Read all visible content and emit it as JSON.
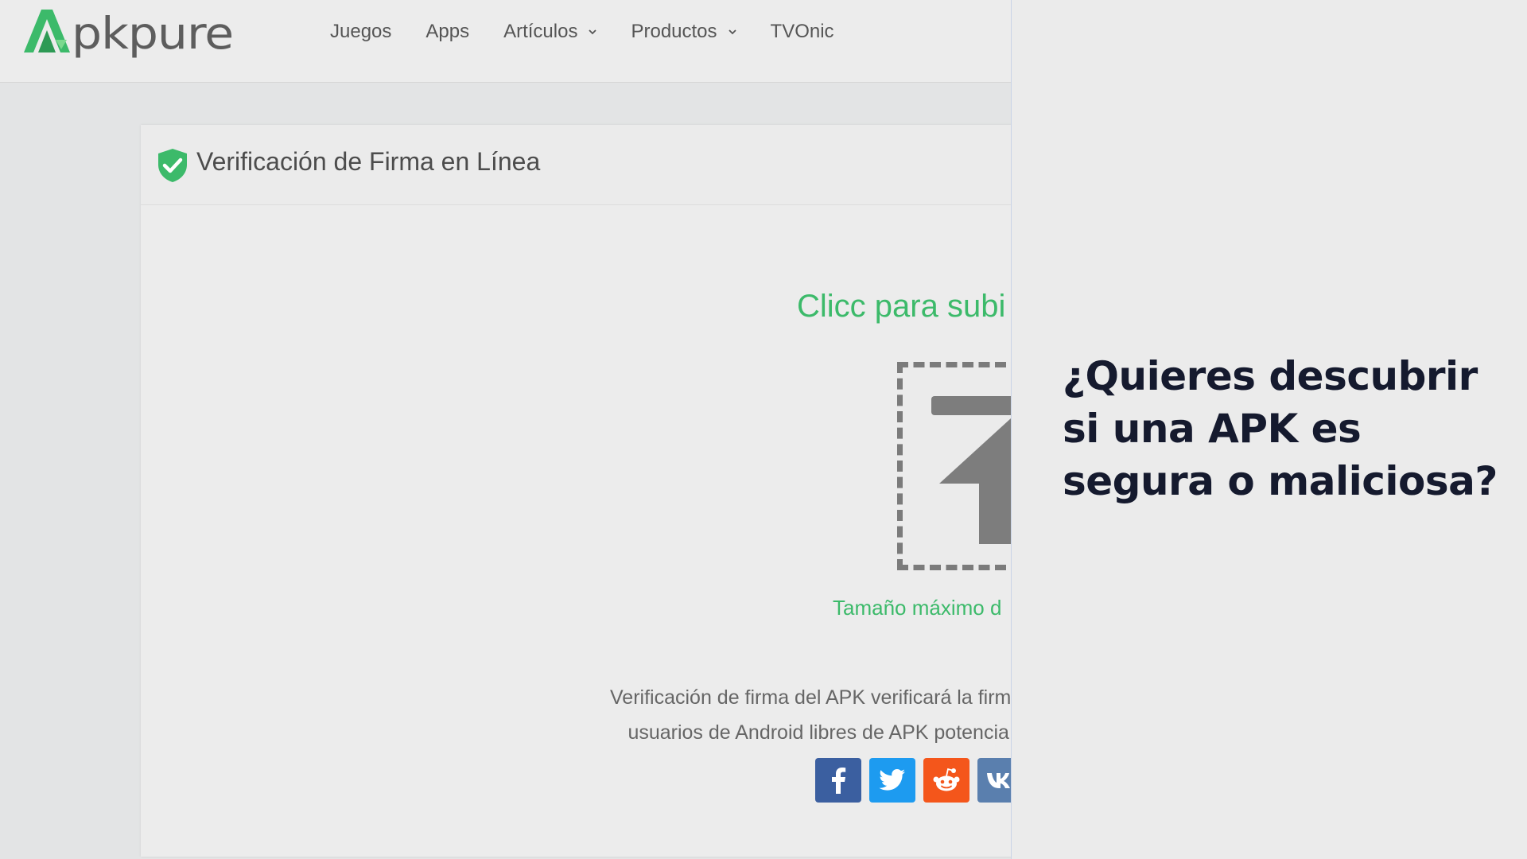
{
  "brand": {
    "logo_text": "pkpure",
    "accent_color": "#3cba6a"
  },
  "nav": {
    "items": [
      {
        "label": "Juegos",
        "dropdown": false
      },
      {
        "label": "Apps",
        "dropdown": false
      },
      {
        "label": "Artículos",
        "dropdown": true
      },
      {
        "label": "Productos",
        "dropdown": true
      },
      {
        "label": "TVOnic",
        "dropdown": false
      }
    ]
  },
  "card": {
    "title": "Verificación de Firma en Línea",
    "upload_title": "Clicc para subi",
    "max_size": "Tamaño máximo d",
    "description_line1": "Verificación de firma del APK verificará la firm",
    "description_line2": "usuarios de Android libres de APK potencia"
  },
  "share": {
    "icons": [
      "facebook-icon",
      "twitter-icon",
      "reddit-icon",
      "vk-icon"
    ]
  },
  "headline": {
    "text": "¿Quieres descubrir si una APK es segura o maliciosa?"
  }
}
